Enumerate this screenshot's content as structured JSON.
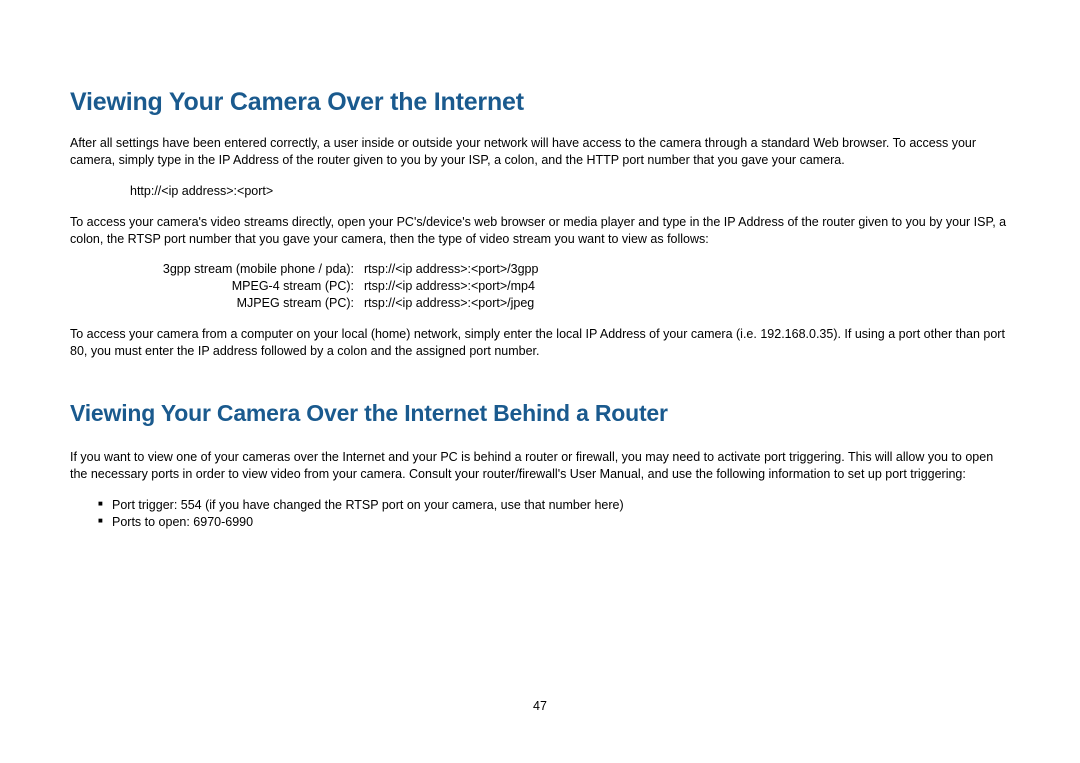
{
  "section1": {
    "heading": "Viewing Your Camera Over the Internet",
    "para1": "After all settings have been entered correctly, a user inside or outside your network will have access to the camera through a standard Web browser. To access your camera, simply type in the IP Address of the router given to you by your ISP, a colon, and the HTTP port number that you gave your camera.",
    "example_url": "http://<ip address>:<port>",
    "para2": "To access your camera's video streams directly, open your PC's/device's web browser or media player and type in the IP Address of the router given to you by your ISP, a colon, the RTSP port number that you gave your camera, then the type of video stream you want to view as follows:",
    "streams": [
      {
        "label": "3gpp stream (mobile phone / pda):",
        "value": "rtsp://<ip address>:<port>/3gpp"
      },
      {
        "label": "MPEG-4 stream (PC):",
        "value": "rtsp://<ip address>:<port>/mp4"
      },
      {
        "label": "MJPEG stream (PC):",
        "value": "rtsp://<ip address>:<port>/jpeg"
      }
    ],
    "para3": "To access your camera from a computer on your local (home) network, simply enter the local IP Address of your camera (i.e. 192.168.0.35). If using a port other than port 80, you must enter the IP address followed by a colon and the assigned port number."
  },
  "section2": {
    "heading": "Viewing Your Camera Over the Internet Behind a Router",
    "para1": "If you want to view one of your cameras over the Internet and your PC is behind a router or firewall, you may need to activate port triggering. This will allow you to open the necessary ports in order to view video from your camera. Consult your router/firewall's User Manual, and use the following information to set up port triggering:",
    "bullets": [
      "Port trigger: 554 (if you have changed the RTSP port on your camera, use that number here)",
      "Ports to open: 6970-6990"
    ]
  },
  "page_number": "47"
}
